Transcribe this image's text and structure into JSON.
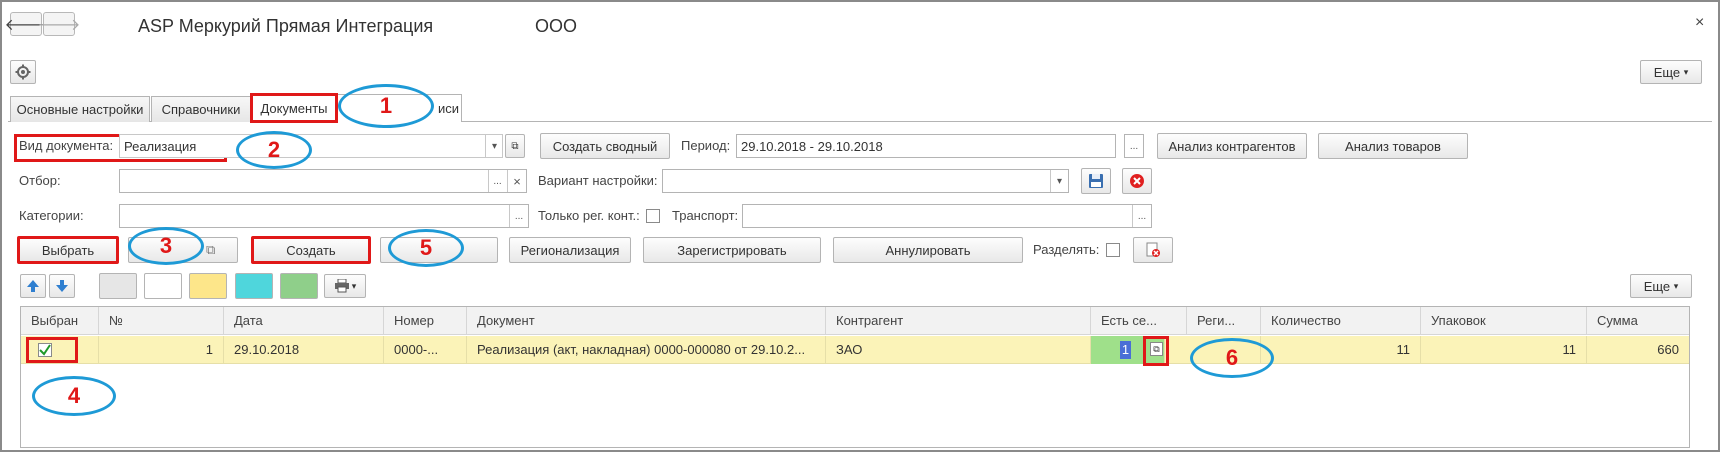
{
  "window": {
    "title": "ASP Меркурий Прямая Интеграция",
    "org": "ООО",
    "close": "×",
    "back": "🡐",
    "forward": "🡒"
  },
  "toolbar": {
    "more": "Еще"
  },
  "tabs": [
    "Основные настройки",
    "Справочники",
    "Документы",
    "Записи"
  ],
  "tab_hidden_fragment": "иси",
  "filters": {
    "doc_type_label": "Вид документа:",
    "doc_type_value": "Реализация",
    "create_summary": "Создать сводный",
    "period_label": "Период:",
    "period_value": "29.10.2018 - 29.10.2018",
    "analyze_counterparties": "Анализ контрагентов",
    "analyze_goods": "Анализ товаров",
    "selection_label": "Отбор:",
    "variant_label": "Вариант настройки:",
    "categories_label": "Категории:",
    "only_reg_label": "Только рег. конт.:",
    "transport_label": "Транспорт:",
    "ellipsis": "...",
    "clear": "×"
  },
  "actions": {
    "select": "Выбрать",
    "create": "Создать",
    "regionalization": "Регионализация",
    "register": "Зарегистрировать",
    "cancel": "Аннулировать",
    "split_label": "Разделять:",
    "more": "Еще"
  },
  "table": {
    "headers": [
      "Выбран",
      "№",
      "Дата",
      "Номер",
      "Документ",
      "Контрагент",
      "Есть се...",
      "Реги...",
      "Количество",
      "Упаковок",
      "Сумма"
    ],
    "rows": [
      {
        "selected": true,
        "num": "1",
        "date": "29.10.2018",
        "number": "0000-...",
        "document": "Реализация (акт, накладная) 0000-000080 от 29.10.2...",
        "counterparty": "ЗАО",
        "has_cert": "1",
        "region": "",
        "quantity": "11",
        "packages": "11",
        "sum": "660"
      }
    ]
  },
  "annotations": [
    "1",
    "2",
    "3",
    "4",
    "5",
    "6"
  ],
  "colors": {
    "row_highlight": "#fbf3b8",
    "cert_cell": "#9fe08a",
    "annotation_red": "#e01818",
    "annotation_blue": "#1e9ad6",
    "swatch_gray": "#e6e6e6",
    "swatch_white": "#ffffff",
    "swatch_yellow": "#fde68a",
    "swatch_cyan": "#4fd6dc",
    "swatch_green": "#8fcf8a"
  }
}
